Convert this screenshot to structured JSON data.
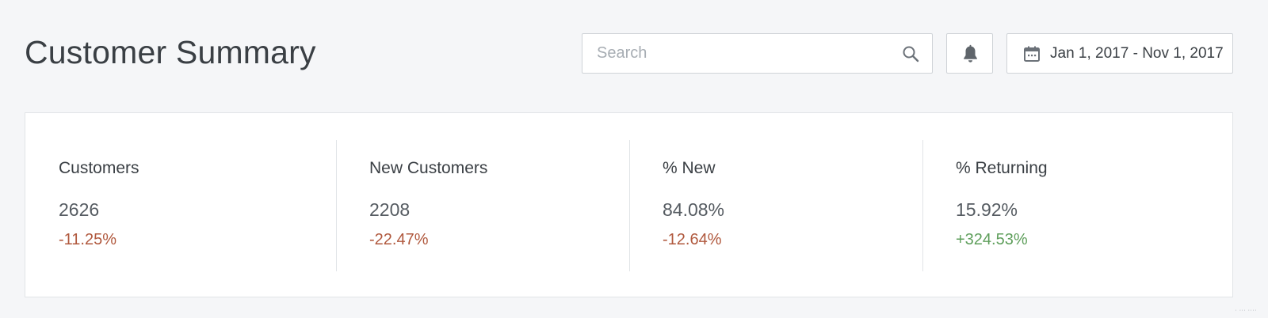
{
  "header": {
    "title": "Customer Summary"
  },
  "search": {
    "placeholder": "Search",
    "value": "",
    "icon": "search-icon"
  },
  "notifications": {
    "icon": "bell-icon"
  },
  "date_range": {
    "icon": "calendar-icon",
    "label": "Jan 1, 2017 - Nov 1, 2017"
  },
  "metrics": [
    {
      "label": "Customers",
      "value": "2626",
      "change": "-11.25%",
      "trend": "negative"
    },
    {
      "label": "New Customers",
      "value": "2208",
      "change": "-22.47%",
      "trend": "negative"
    },
    {
      "label": "% New",
      "value": "84.08%",
      "change": "-12.64%",
      "trend": "negative"
    },
    {
      "label": "% Returning",
      "value": "15.92%",
      "change": "+324.53%",
      "trend": "positive"
    }
  ],
  "colors": {
    "background": "#f5f6f8",
    "card": "#ffffff",
    "border": "#cfd3d7",
    "negative": "#b0583d",
    "positive": "#5f9f5c",
    "text": "#3a3f44"
  },
  "footer": {
    "corner_mark": "· ··· ····"
  }
}
